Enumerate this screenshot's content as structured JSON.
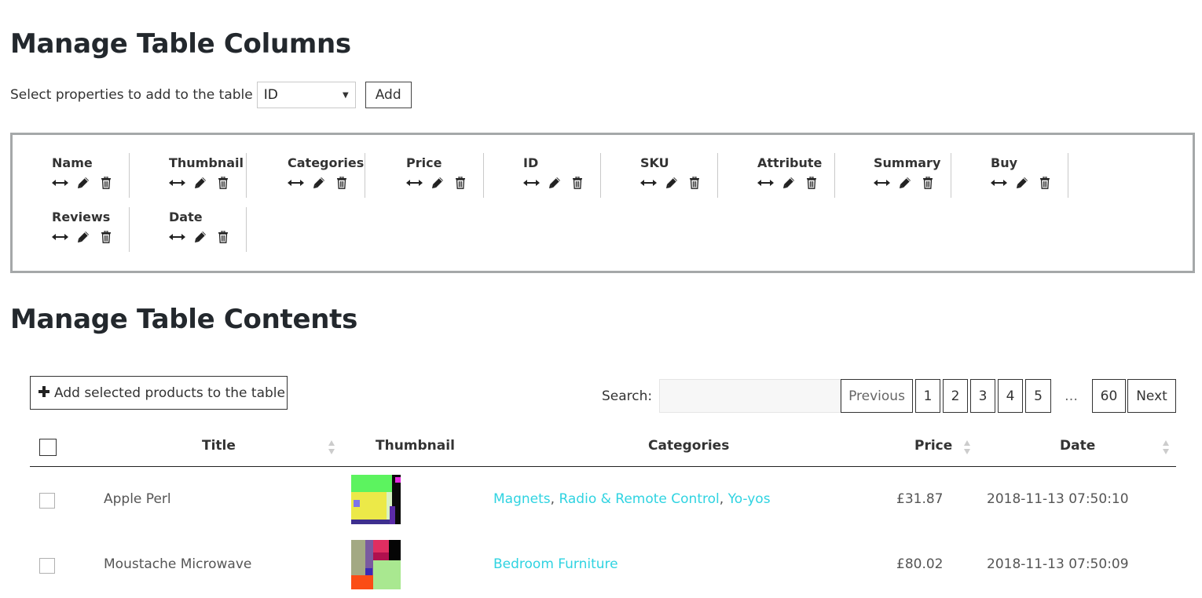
{
  "columns_section": {
    "title": "Manage Table Columns",
    "select_label": "Select properties to add to the table",
    "select_value": "ID",
    "add_button": "Add",
    "columns": [
      {
        "name": "Name"
      },
      {
        "name": "Thumbnail"
      },
      {
        "name": "Categories"
      },
      {
        "name": "Price"
      },
      {
        "name": "ID"
      },
      {
        "name": "SKU"
      },
      {
        "name": "Attribute"
      },
      {
        "name": "Summary"
      },
      {
        "name": "Buy"
      },
      {
        "name": "Reviews"
      },
      {
        "name": "Date"
      }
    ],
    "column_icons": [
      "resize-icon",
      "pencil-icon",
      "trash-icon"
    ]
  },
  "contents_section": {
    "title": "Manage Table Contents",
    "add_selected_button": "Add selected products to the table",
    "search_label": "Search:",
    "search_value": "",
    "pagination": {
      "previous": "Previous",
      "pages": [
        "1",
        "2",
        "3",
        "4",
        "5"
      ],
      "ellipsis": "…",
      "last": "60",
      "next": "Next"
    },
    "headers": {
      "title": "Title",
      "thumbnail": "Thumbnail",
      "categories": "Categories",
      "price": "Price",
      "date": "Date"
    },
    "rows": [
      {
        "title": "Apple Perl",
        "categories": [
          "Magnets",
          "Radio & Remote Control",
          "Yo-yos"
        ],
        "separator": ", ",
        "price": "£31.87",
        "date": "2018-11-13 07:50:10"
      },
      {
        "title": "Moustache Microwave",
        "categories": [
          "Bedroom Furniture"
        ],
        "separator": ", ",
        "price": "£80.02",
        "date": "2018-11-13 07:50:09"
      }
    ]
  },
  "colors": {
    "heading": "#23282d",
    "link": "#2fd3e1",
    "box_border": "#a5a8a9"
  }
}
